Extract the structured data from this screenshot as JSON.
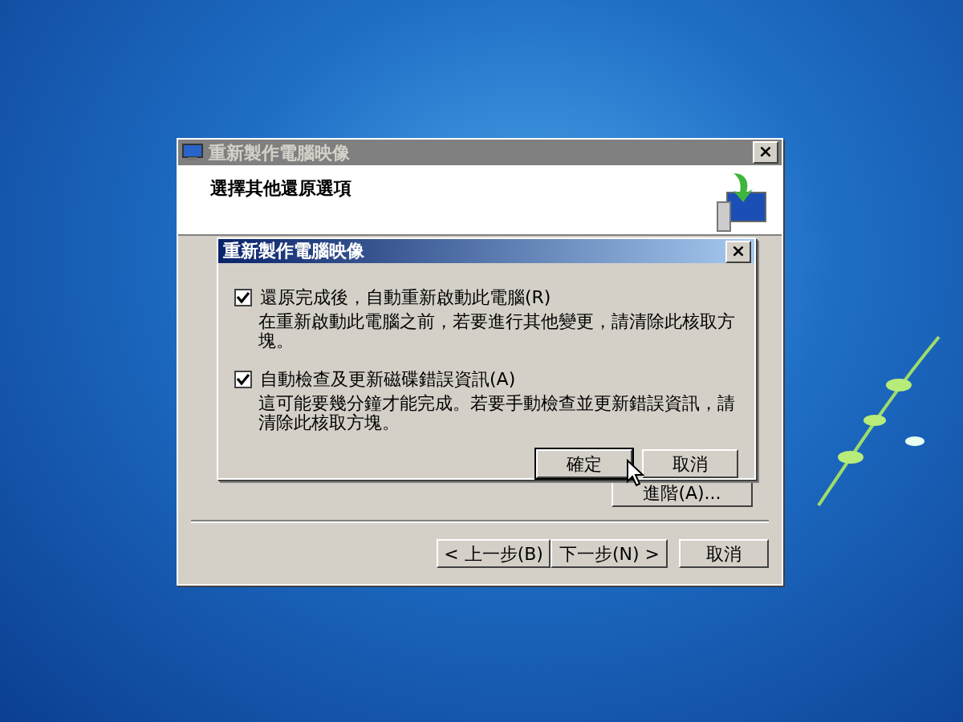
{
  "main_window": {
    "title": "重新製作電腦映像",
    "heading": "選擇其他還原選項",
    "advanced_button": "進階(A)...",
    "buttons": [
      {
        "label": "< 上一步(B)",
        "kind": "back"
      },
      {
        "label": "下一步(N) >",
        "kind": "next"
      },
      {
        "label": "取消",
        "kind": "cancel"
      }
    ]
  },
  "dialog": {
    "title": "重新製作電腦映像",
    "close": "×",
    "options": [
      {
        "label": "還原完成後，自動重新啟動此電腦(R)",
        "checked": true,
        "description": "在重新啟動此電腦之前，若要進行其他變更，請清除此核取方塊。"
      },
      {
        "label": "自動檢查及更新磁碟錯誤資訊(A)",
        "checked": true,
        "description": "這可能要幾分鐘才能完成。若要手動檢查並更新錯誤資訊，請清除此核取方塊。"
      }
    ],
    "buttons": [
      {
        "label": "確定",
        "kind": "ok"
      },
      {
        "label": "取消",
        "kind": "cancel"
      }
    ]
  },
  "main_close": "×"
}
